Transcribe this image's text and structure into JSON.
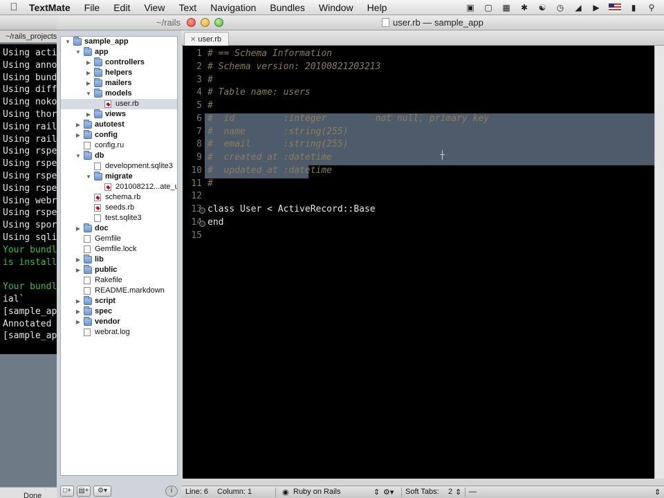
{
  "menubar": {
    "app_name": "TextMate",
    "items": [
      "File",
      "Edit",
      "View",
      "Text",
      "Navigation",
      "Bundles",
      "Window",
      "Help"
    ]
  },
  "terminal": {
    "tab_label": "~/rails_projects",
    "lines": [
      "Using acti",
      "Using anno",
      "Using bund",
      "Using diff",
      "Using noko",
      "Using thor",
      "Using rail",
      "Using rail",
      "Using rspe",
      "Using rspe",
      "Using rspe",
      "Using rspe",
      "Using webr",
      "Using rspe",
      "Using spor",
      "Using sqli"
    ],
    "green_lines": [
      "Your bundl",
      "is install"
    ],
    "blank": "",
    "green_lines2": [
      "Your bundl"
    ],
    "tail_lines": [
      "ial`",
      "[sample_ap",
      "Annotated",
      "[sample_ap"
    ],
    "status": "Done"
  },
  "window": {
    "rails_path": "~/rails",
    "title": "user.rb — sample_app"
  },
  "tree": {
    "root": "sample_app",
    "items": [
      {
        "label": "app",
        "bold": true
      },
      {
        "label": "controllers",
        "bold": true
      },
      {
        "label": "helpers",
        "bold": true
      },
      {
        "label": "mailers",
        "bold": true
      },
      {
        "label": "models",
        "bold": true
      },
      {
        "label": "user.rb",
        "bold": false
      },
      {
        "label": "views",
        "bold": true
      },
      {
        "label": "autotest",
        "bold": true
      },
      {
        "label": "config",
        "bold": true
      },
      {
        "label": "config.ru",
        "bold": false
      },
      {
        "label": "db",
        "bold": true
      },
      {
        "label": "development.sqlite3",
        "bold": false
      },
      {
        "label": "migrate",
        "bold": true
      },
      {
        "label": "20100821​2...ate_u",
        "bold": false
      },
      {
        "label": "schema.rb",
        "bold": false
      },
      {
        "label": "seeds.rb",
        "bold": false
      },
      {
        "label": "test.sqlite3",
        "bold": false
      },
      {
        "label": "doc",
        "bold": true
      },
      {
        "label": "Gemfile",
        "bold": false
      },
      {
        "label": "Gemfile.lock",
        "bold": false
      },
      {
        "label": "lib",
        "bold": true
      },
      {
        "label": "public",
        "bold": true
      },
      {
        "label": "Rakefile",
        "bold": false
      },
      {
        "label": "README.markdown",
        "bold": false
      },
      {
        "label": "script",
        "bold": true
      },
      {
        "label": "spec",
        "bold": true
      },
      {
        "label": "vendor",
        "bold": true
      },
      {
        "label": "webrat.log",
        "bold": false
      }
    ],
    "footer_icons": [
      "new-file-icon",
      "new-folder-icon",
      "gear-icon",
      "info-icon"
    ]
  },
  "editor": {
    "tab_label": "user.rb",
    "line_numbers": [
      "1",
      "2",
      "3",
      "4",
      "5",
      "6",
      "7",
      "8",
      "9",
      "10",
      "11",
      "12",
      "13",
      "14",
      "15"
    ],
    "lines": [
      "# == Schema Information",
      "# Schema version: 20100821203213",
      "#",
      "# Table name: users",
      "#",
      "#  id         :integer         not null, primary key",
      "#  name       :string(255)",
      "#  email      :string(255)",
      "#  created_at :datetime",
      "#  updated_at :datetime",
      "#",
      "",
      "class User < ActiveRecord::Base",
      "end",
      ""
    ]
  },
  "status": {
    "line": "Line: 6",
    "column": "Column: 1",
    "language": "Ruby on Rails",
    "tabs_label": "Soft Tabs:",
    "tabs_value": "2",
    "symbol": "—"
  },
  "colors": {
    "comment": "#8c7d5c",
    "selection": "#4e5b6b",
    "terminal_green": "#3fbf3f"
  }
}
